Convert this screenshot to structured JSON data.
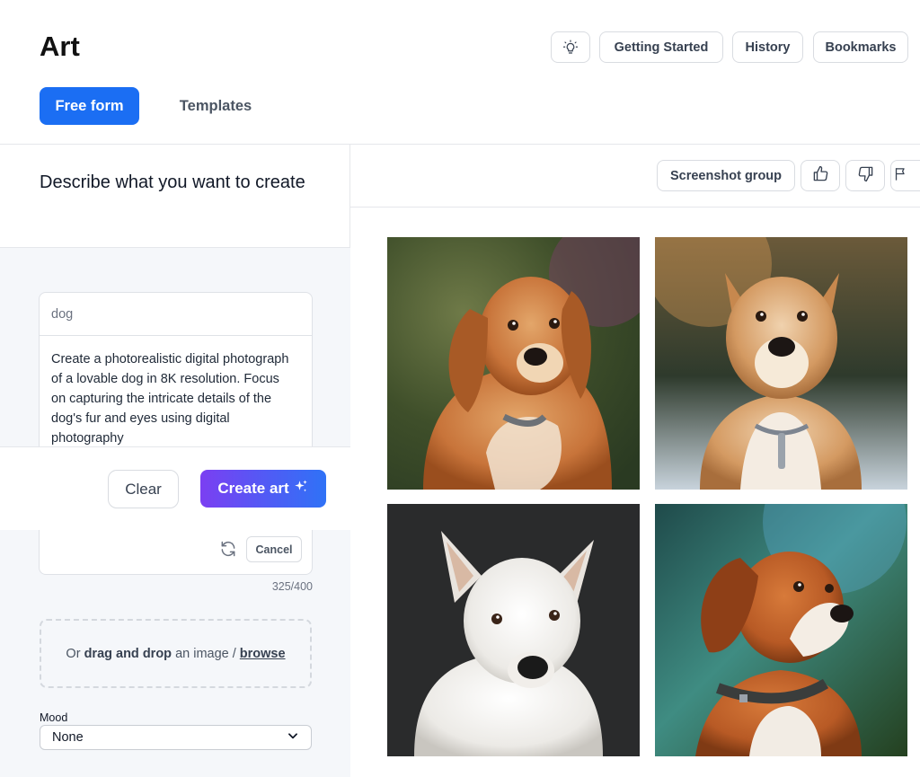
{
  "header": {
    "title": "Art",
    "tip_icon": "lightbulb-icon",
    "buttons": {
      "getting_started": "Getting Started",
      "history": "History",
      "bookmarks": "Bookmarks"
    }
  },
  "tabs": {
    "free_form": "Free form",
    "templates": "Templates",
    "active": "Free form"
  },
  "left_panel": {
    "title": "Describe what you want to create",
    "keyword_value": "dog",
    "prompt_text": "Create a photorealistic digital photograph of a lovable dog in 8K resolution. Focus on capturing the intricate details of the dog's fur and eyes using digital photography",
    "clear_label": "Clear",
    "create_label": "Create art",
    "create_icon": "sparkle-icon",
    "refresh_icon": "refresh-icon",
    "cancel_label": "Cancel",
    "char_count": "325/400",
    "dropzone": {
      "prefix": "Or",
      "bold": "drag and drop",
      "middle": "an image /",
      "browse": "browse"
    },
    "mood": {
      "label": "Mood",
      "value": "None"
    }
  },
  "results_toolbar": {
    "screenshot_group": "Screenshot group",
    "like_icon": "thumbs-up-icon",
    "dislike_icon": "thumbs-down-icon",
    "flag_icon": "flag-icon"
  },
  "images": [
    {
      "name": "golden-retriever",
      "fur": "#c8743a"
    },
    {
      "name": "fluffy-tan-dog",
      "fur": "#d49a62"
    },
    {
      "name": "white-dog",
      "fur": "#f2f2f0"
    },
    {
      "name": "beagle-dog",
      "fur": "#b85a25"
    }
  ],
  "colors": {
    "primary": "#1b6ef3",
    "create_gradient_start": "#7b3ff2",
    "create_gradient_end": "#2f72f6"
  }
}
